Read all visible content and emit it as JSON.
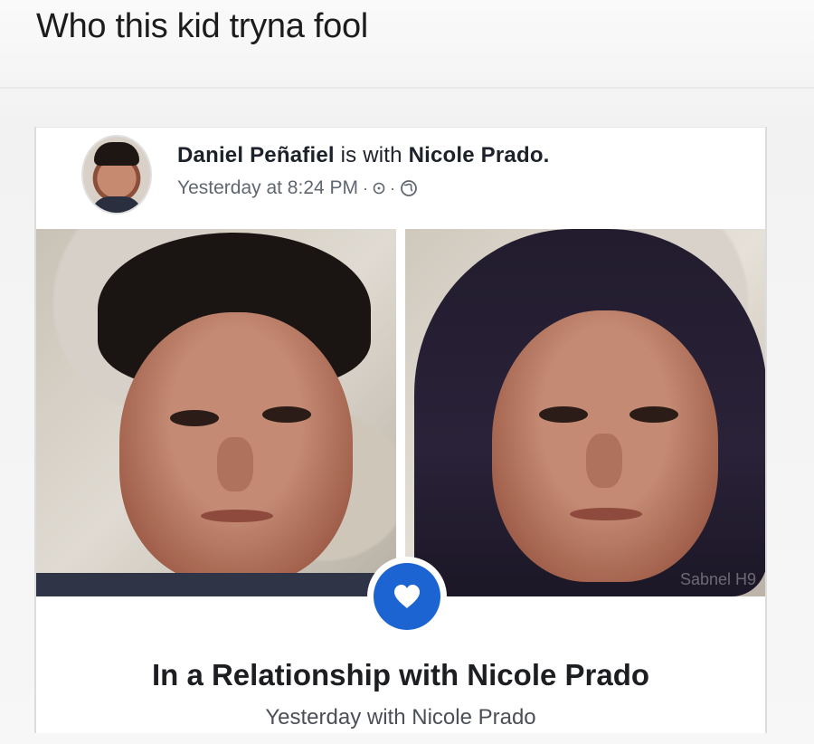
{
  "caption": "Who this kid tryna fool",
  "post": {
    "author": "Daniel Peñafiel",
    "connector": "is with",
    "tagged": "Nicole Prado.",
    "timestamp": "Yesterday at 8:24 PM",
    "separator": "·",
    "icons": [
      "clock-icon",
      "globe-icon"
    ]
  },
  "photos": {
    "watermark": "Sabnel H9"
  },
  "life_event": {
    "title": "In a Relationship with Nicole Prado",
    "subtitle": "Yesterday with Nicole Prado",
    "icon": "heart-icon",
    "accent": "#1c64d1"
  }
}
